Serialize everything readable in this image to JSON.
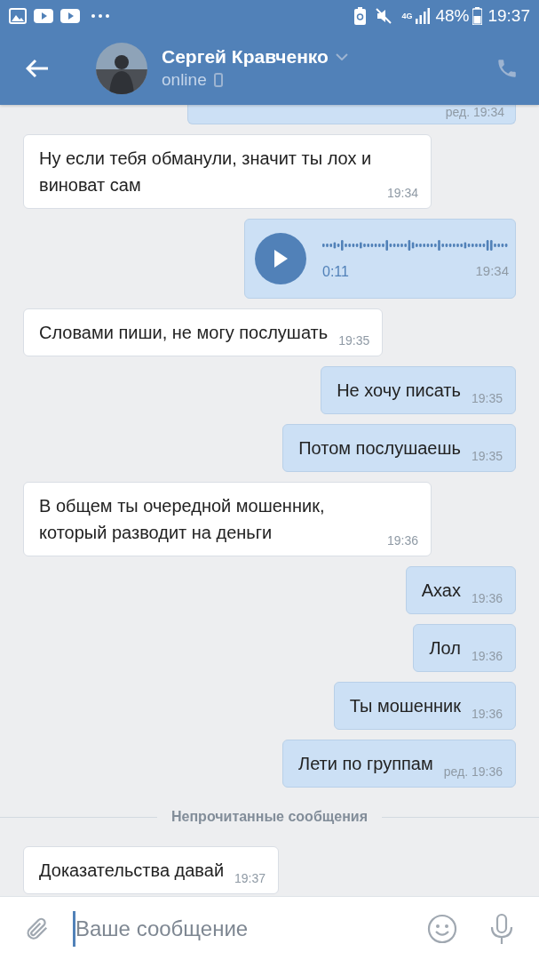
{
  "status_bar": {
    "battery": "48%",
    "time": "19:37",
    "network": "4G"
  },
  "header": {
    "name": "Сергей Кравченко",
    "status": "online"
  },
  "messages": [
    {
      "kind": "clipped",
      "outgoing": true,
      "time": "ред. 19:34"
    },
    {
      "kind": "text",
      "outgoing": false,
      "text": "Ну если тебя обманули, значит ты лох и виноват сам",
      "time": "19:34"
    },
    {
      "kind": "voice",
      "outgoing": true,
      "duration": "0:11",
      "time": "19:34"
    },
    {
      "kind": "text",
      "outgoing": false,
      "text": "Словами пиши, не могу послушать",
      "time": "19:35"
    },
    {
      "kind": "text",
      "outgoing": true,
      "text": "Не хочу писать",
      "time": "19:35"
    },
    {
      "kind": "text",
      "outgoing": true,
      "text": "Потом послушаешь",
      "time": "19:35"
    },
    {
      "kind": "text",
      "outgoing": false,
      "text": "В общем ты очередной мошенник, который разводит на деньги",
      "time": "19:36"
    },
    {
      "kind": "text",
      "outgoing": true,
      "text": "Ахах",
      "time": "19:36"
    },
    {
      "kind": "text",
      "outgoing": true,
      "text": "Лол",
      "time": "19:36"
    },
    {
      "kind": "text",
      "outgoing": true,
      "text": "Ты мошенник",
      "time": "19:36"
    },
    {
      "kind": "text",
      "outgoing": true,
      "text": "Лети по группам",
      "time": "ред. 19:36"
    },
    {
      "kind": "divider",
      "text": "Непрочитанные сообщения"
    },
    {
      "kind": "text",
      "outgoing": false,
      "text": "Доказательства давай",
      "time": "19:37"
    }
  ],
  "composer": {
    "placeholder": "Ваше сообщение"
  }
}
